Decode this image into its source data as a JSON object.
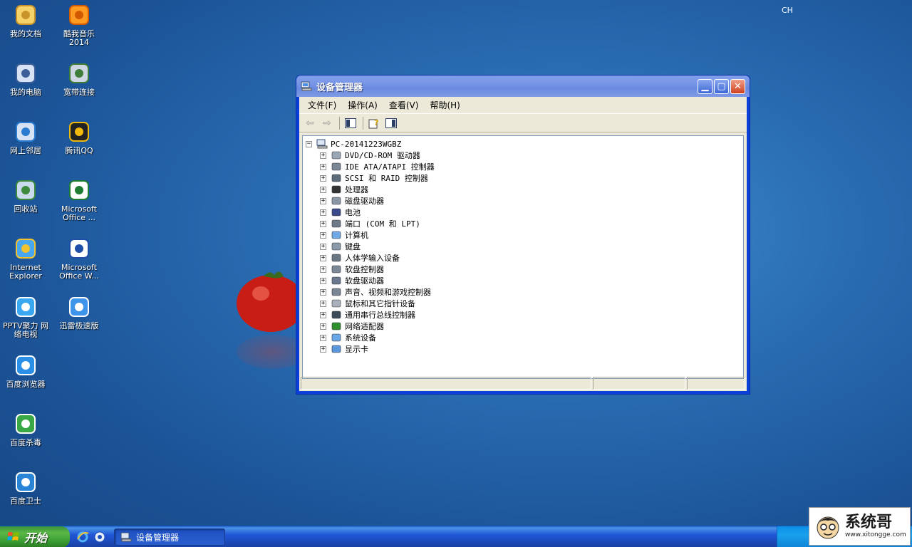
{
  "desktop": {
    "icons": [
      {
        "label": "我的文档",
        "icon": "my-documents-icon"
      },
      {
        "label": "酷我音乐",
        "label2": "2014",
        "icon": "kuwo-music-icon"
      },
      {
        "label": "我的电脑",
        "icon": "my-computer-icon"
      },
      {
        "label": "宽带连接",
        "icon": "broadband-connection-icon"
      },
      {
        "label": "网上邻居",
        "icon": "network-places-icon"
      },
      {
        "label": "腾讯QQ",
        "icon": "qq-icon"
      },
      {
        "label": "回收站",
        "icon": "recycle-bin-icon"
      },
      {
        "label": "Microsoft",
        "label2": "Office ...",
        "icon": "excel-icon"
      },
      {
        "label": "Internet",
        "label2": "Explorer",
        "icon": "internet-explorer-icon"
      },
      {
        "label": "Microsoft",
        "label2": "Office W...",
        "icon": "word-icon"
      },
      {
        "label": "PPTV聚力 网",
        "label2": "络电视",
        "icon": "pptv-icon"
      },
      {
        "label": "迅雷极速版",
        "icon": "xunlei-icon"
      },
      {
        "label": "百度浏览器",
        "icon": "baidu-browser-icon"
      },
      {
        "label": "百度杀毒",
        "icon": "baidu-antivirus-icon"
      },
      {
        "label": "百度卫士",
        "icon": "baidu-guard-icon"
      }
    ]
  },
  "window": {
    "title": "设备管理器",
    "menu": [
      "文件(F)",
      "操作(A)",
      "查看(V)",
      "帮助(H)"
    ],
    "tree": {
      "root": "PC-20141223WGBZ",
      "items": [
        {
          "label": "DVD/CD-ROM 驱动器",
          "icon": "cdrom-icon"
        },
        {
          "label": "IDE ATA/ATAPI 控制器",
          "icon": "ide-controller-icon"
        },
        {
          "label": "SCSI 和 RAID 控制器",
          "icon": "scsi-icon"
        },
        {
          "label": "处理器",
          "icon": "processor-icon"
        },
        {
          "label": "磁盘驱动器",
          "icon": "disk-drive-icon"
        },
        {
          "label": "电池",
          "icon": "battery-icon"
        },
        {
          "label": "端口 (COM 和 LPT)",
          "icon": "port-icon"
        },
        {
          "label": "计算机",
          "icon": "computer-icon"
        },
        {
          "label": "键盘",
          "icon": "keyboard-icon"
        },
        {
          "label": "人体学输入设备",
          "icon": "hid-icon"
        },
        {
          "label": "软盘控制器",
          "icon": "floppy-controller-icon"
        },
        {
          "label": "软盘驱动器",
          "icon": "floppy-drive-icon"
        },
        {
          "label": "声音、视频和游戏控制器",
          "icon": "sound-icon"
        },
        {
          "label": "鼠标和其它指针设备",
          "icon": "mouse-icon"
        },
        {
          "label": "通用串行总线控制器",
          "icon": "usb-icon"
        },
        {
          "label": "网络适配器",
          "icon": "network-adapter-icon"
        },
        {
          "label": "系统设备",
          "icon": "system-device-icon"
        },
        {
          "label": "显示卡",
          "icon": "display-adapter-icon"
        }
      ]
    }
  },
  "taskbar": {
    "start_label": "开始",
    "task_title": "设备管理器",
    "language": "CH"
  },
  "brand": {
    "title": "系统哥",
    "url": "www.xitongge.com"
  }
}
